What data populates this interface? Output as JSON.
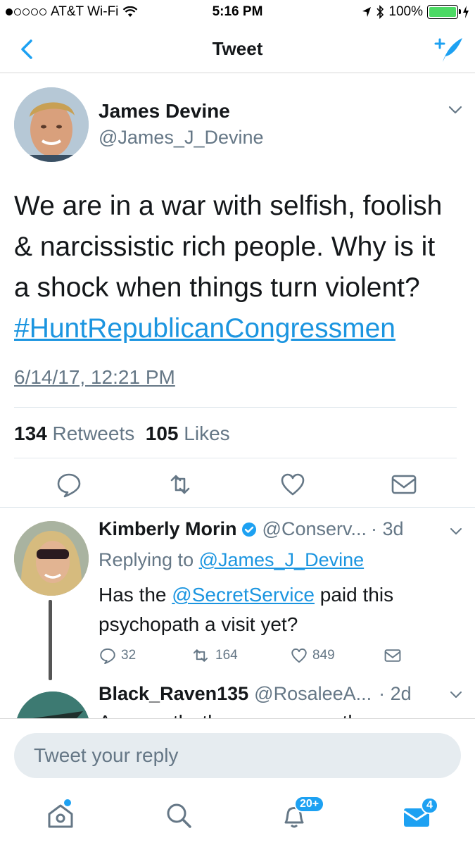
{
  "status_bar": {
    "carrier": "AT&T Wi-Fi",
    "time": "5:16 PM",
    "battery": "100%",
    "battery_level": 1.0
  },
  "nav": {
    "title": "Tweet",
    "back_icon": "chevron-left-icon",
    "compose_icon": "compose-tweet-icon"
  },
  "tweet": {
    "author_name": "James Devine",
    "author_handle": "@James_J_Devine",
    "text_lines": [
      "We are in a war with selfish, foolish",
      "& narcissistic rich people. Why is it",
      "a shock when things turn violent?"
    ],
    "hashtag": "#HuntRepublicanCongressmen",
    "date": "6/14/17, 12:21 PM",
    "retweets_count": "134",
    "retweets_label": "Retweets",
    "likes_count": "105",
    "likes_label": "Likes",
    "actions": [
      "reply-icon",
      "retweet-icon",
      "like-icon",
      "dm-icon"
    ]
  },
  "replies": [
    {
      "name": "Kimberly Morin",
      "handle": "@Conserv...",
      "time": "· 3d",
      "verified": true,
      "replying_prefix": "Replying to",
      "replying_to": "@James_J_Devine",
      "text_before": "Has the",
      "mention": "@SecretService",
      "text_after": "paid this psychopath a visit yet?",
      "reply_count": "32",
      "retweet_count": "164",
      "like_count": "849"
    },
    {
      "name": "Black_Raven135",
      "handle": "@RosaleeA...",
      "time": "· 2d",
      "text_partial": "Apparently, there are currently a"
    }
  ],
  "reply_box": {
    "placeholder": "Tweet your reply"
  },
  "tabbar": {
    "notifications_badge": "20+",
    "messages_badge": "4",
    "accent": "#1da1f2"
  }
}
